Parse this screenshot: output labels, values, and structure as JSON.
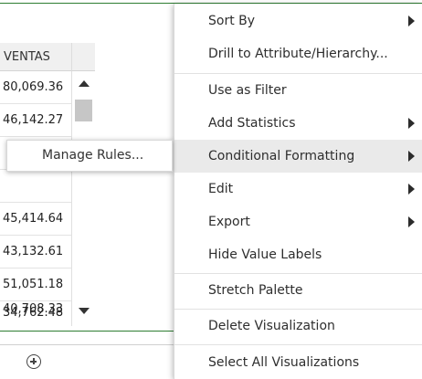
{
  "table": {
    "header": "VENTAS",
    "rows": [
      "80,069.36",
      "46,142.27",
      "",
      "",
      "45,414.64",
      "43,132.61",
      "51,051.18",
      "40,708.33",
      "34,762.48"
    ]
  },
  "submenu": {
    "manage_rules": "Manage Rules..."
  },
  "context_menu": {
    "sort_by": "Sort By",
    "drill": "Drill to Attribute/Hierarchy...",
    "use_as_filter": "Use as Filter",
    "add_statistics": "Add Statistics",
    "conditional_formatting": "Conditional Formatting",
    "edit": "Edit",
    "export": "Export",
    "hide_value_labels": "Hide Value Labels",
    "stretch_palette": "Stretch Palette",
    "delete_visualization": "Delete Visualization",
    "select_all_visualizations": "Select All Visualizations"
  },
  "icons": {
    "add": "add-circle-icon",
    "submenu_arrow": "chevron-right-icon",
    "scroll_up": "triangle-up-icon",
    "scroll_down": "triangle-down-icon"
  },
  "colors": {
    "accent_line": "#2e7d32",
    "active_item": "#eaeaea"
  }
}
